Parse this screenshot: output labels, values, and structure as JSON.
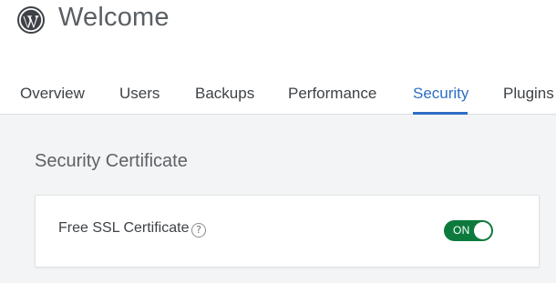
{
  "header": {
    "logo_icon": "wordpress-logo-icon",
    "title": "Welcome"
  },
  "tabs": [
    {
      "label": "Overview",
      "active": false
    },
    {
      "label": "Users",
      "active": false
    },
    {
      "label": "Backups",
      "active": false
    },
    {
      "label": "Performance",
      "active": false
    },
    {
      "label": "Security",
      "active": true
    },
    {
      "label": "Plugins",
      "active": false
    }
  ],
  "section": {
    "title": "Security Certificate"
  },
  "card": {
    "label": "Free SSL Certificate",
    "help_icon": "question-circle-icon",
    "help_glyph": "?",
    "toggle": {
      "state_text": "ON",
      "checked": true
    }
  },
  "colors": {
    "accent": "#2d6ec4",
    "toggle_on": "#0d7a3d",
    "background": "#f3f4f5"
  }
}
